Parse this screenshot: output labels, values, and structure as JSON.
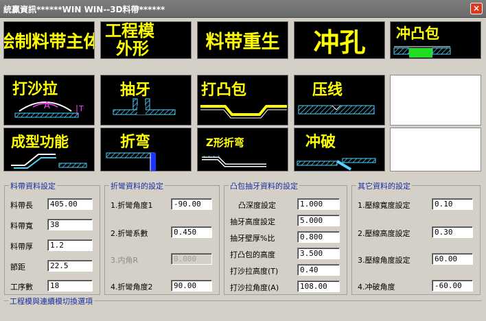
{
  "window": {
    "title": "統贏資訊******WIN WIN--3D料帶******",
    "close_glyph": "×"
  },
  "tiles": {
    "t1": "绘制料带主体",
    "t2a": "工程模",
    "t2b": "外形",
    "t3": "料带重生",
    "t4": "冲孔",
    "t5": "冲凸包",
    "t6": "打沙拉",
    "t6a": "A",
    "t6b": "T",
    "t7": "抽牙",
    "t8": "打凸包",
    "t9": "压线",
    "t11": "成型功能",
    "t12": "折弯",
    "t13": "Z形折弯",
    "t14": "冲破"
  },
  "groups": {
    "strip": {
      "title": "料帶資料設定",
      "rows": [
        {
          "label": "料帶長",
          "value": "405.00"
        },
        {
          "label": "料帶寬",
          "value": "38"
        },
        {
          "label": "料帶厚",
          "value": "1.2"
        },
        {
          "label": "節距",
          "value": "22.5"
        },
        {
          "label": "工序數",
          "value": "18"
        }
      ]
    },
    "bend": {
      "title": "折彎資料的設定",
      "rows": [
        {
          "label": "1.折彎角度1",
          "value": "-90.00"
        },
        {
          "label": "2.折彎系數",
          "value": "0.450"
        },
        {
          "label": "3.内角R",
          "value": "0.000"
        },
        {
          "label": "4.折彎角度2",
          "value": "90.00"
        }
      ]
    },
    "emboss": {
      "title": "凸包抽牙資料的設定",
      "rows": [
        {
          "label": "凸深度設定",
          "value": "1.000"
        },
        {
          "label": "抽牙高度設定",
          "value": "5.000"
        },
        {
          "label": "抽牙壁厚%比",
          "value": "0.800"
        },
        {
          "label": "打凸包的高度",
          "value": "3.500"
        },
        {
          "label": "打沙拉高度(T)",
          "value": "0.40"
        },
        {
          "label": "打沙拉角度(A)",
          "value": "108.00"
        }
      ]
    },
    "other": {
      "title": "其它資料的設定",
      "rows": [
        {
          "label": "1.壓線寬度設定",
          "value": "0.10"
        },
        {
          "label": "2.壓線高度設定",
          "value": "0.30"
        },
        {
          "label": "3.壓線角度設定",
          "value": "60.00"
        },
        {
          "label": "4.冲破角度",
          "value": "-60.00"
        }
      ]
    },
    "mode": {
      "title": "工程模與連續模切換選項"
    }
  },
  "colors": {
    "tile_text": "#ffff00",
    "tile_bg": "#000000",
    "group_title": "#1a2fa0",
    "close": "#d93a1f"
  }
}
